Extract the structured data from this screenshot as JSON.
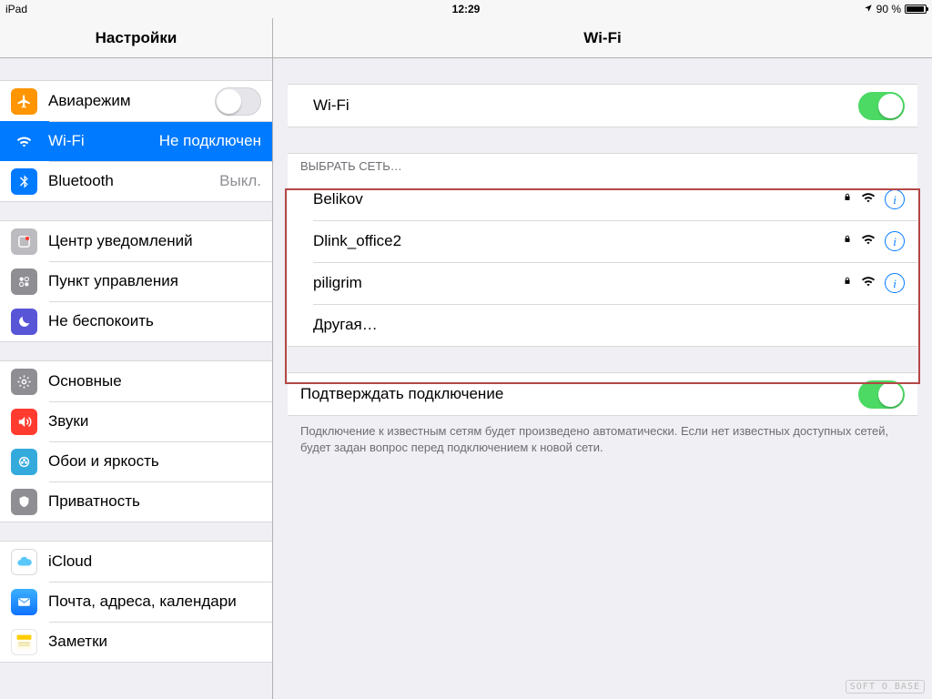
{
  "status": {
    "device": "iPad",
    "time": "12:29",
    "battery_pct": "90 %"
  },
  "side": {
    "title": "Настройки",
    "group1": {
      "airplane": {
        "label": "Авиарежим",
        "on": false
      },
      "wifi": {
        "label": "Wi-Fi",
        "value": "Не подключен"
      },
      "bluetooth": {
        "label": "Bluetooth",
        "value": "Выкл."
      }
    },
    "group2": {
      "notif": {
        "label": "Центр уведомлений"
      },
      "control": {
        "label": "Пункт управления"
      },
      "dnd": {
        "label": "Не беспокоить"
      }
    },
    "group3": {
      "general": {
        "label": "Основные"
      },
      "sounds": {
        "label": "Звуки"
      },
      "wallpaper": {
        "label": "Обои и яркость"
      },
      "privacy": {
        "label": "Приватность"
      }
    },
    "group4": {
      "icloud": {
        "label": "iCloud"
      },
      "mail": {
        "label": "Почта, адреса, календари"
      },
      "notes": {
        "label": "Заметки"
      }
    }
  },
  "main": {
    "title": "Wi-Fi",
    "wifi_row": {
      "label": "Wi-Fi",
      "on": true
    },
    "choose_header": "ВЫБРАТЬ СЕТЬ…",
    "networks": [
      {
        "name": "Belikov",
        "locked": true
      },
      {
        "name": "Dlink_office2",
        "locked": true
      },
      {
        "name": "piligrim",
        "locked": true
      }
    ],
    "other_label": "Другая…",
    "ask_row": {
      "label": "Подтверждать подключение",
      "on": true
    },
    "ask_hint": "Подключение к известным сетям будет произведено автоматически. Если нет известных доступных сетей, будет задан вопрос перед подключением к новой сети."
  },
  "watermark": "SOFT O BASE"
}
